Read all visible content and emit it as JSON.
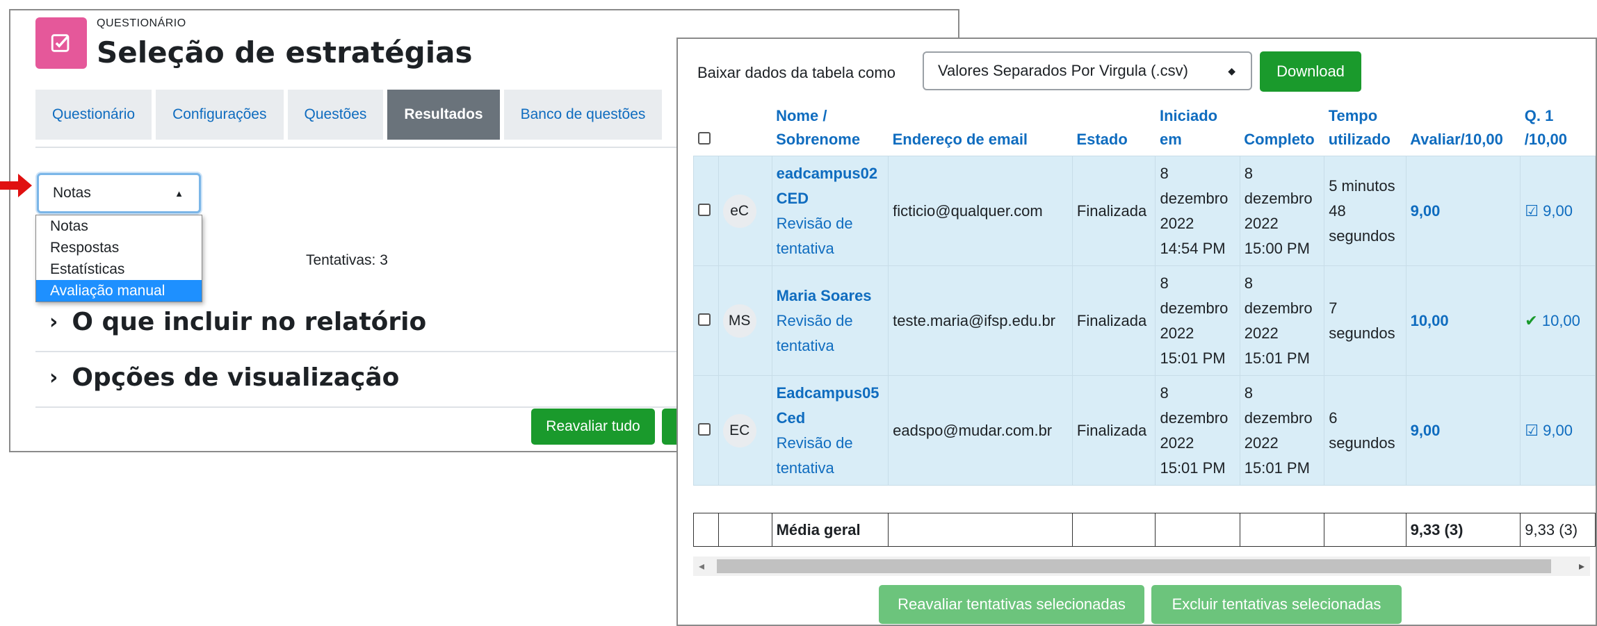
{
  "quiz": {
    "type_label": "QUESTIONÁRIO",
    "title": "Seleção de estratégias"
  },
  "tabs": [
    {
      "label": "Questionário"
    },
    {
      "label": "Configurações"
    },
    {
      "label": "Questões"
    },
    {
      "label": "Resultados",
      "active": true
    },
    {
      "label": "Banco de questões"
    }
  ],
  "report_select": {
    "value": "Notas",
    "options": [
      "Notas",
      "Respostas",
      "Estatísticas",
      "Avaliação manual"
    ],
    "highlighted": "Avaliação manual"
  },
  "tentativas": "Tentativas: 3",
  "sections": {
    "include": "O que incluir no relatório",
    "display": "Opções de visualização"
  },
  "regrade_all": "Reavaliar tudo",
  "export": {
    "label": "Baixar dados da tabela como",
    "format": "Valores Separados Por Virgula (.csv)",
    "download": "Download"
  },
  "headers": {
    "name1": "Nome /",
    "name2": "Sobrenome",
    "email": "Endereço de email",
    "state": "Estado",
    "started1": "Iniciado",
    "started2": "em",
    "completed": "Completo",
    "time1": "Tempo",
    "time2": "utilizado",
    "grade": "Avaliar/10,00",
    "q1a": "Q. 1",
    "q1b": "/10,00"
  },
  "rows": [
    {
      "initials": "eC",
      "name": "eadcampus02 CED",
      "review": "Revisão de tentativa",
      "email": "ficticio@qualquer.com",
      "state": "Finalizada",
      "started": "8 dezembro 2022 14:54 PM",
      "completed": "8 dezembro 2022 15:00 PM",
      "time": "5 minutos 48 segundos",
      "grade": "9,00",
      "q1": "9,00"
    },
    {
      "initials": "MS",
      "name": "Maria Soares",
      "review": "Revisão de tentativa",
      "email": "teste.maria@ifsp.edu.br",
      "state": "Finalizada",
      "started": "8 dezembro 2022 15:01 PM",
      "completed": "8 dezembro 2022 15:01 PM",
      "time": "7 segundos",
      "grade": "10,00",
      "q1": "10,00"
    },
    {
      "initials": "EC",
      "name": "Eadcampus05 Ced",
      "review": "Revisão de tentativa",
      "email": "eadspo@mudar.com.br",
      "state": "Finalizada",
      "started": "8 dezembro 2022 15:01 PM",
      "completed": "8 dezembro 2022 15:01 PM",
      "time": "6 segundos",
      "grade": "9,00",
      "q1": "9,00"
    }
  ],
  "summary": {
    "label": "Média geral",
    "grade": "9,33 (3)",
    "q1": "9,33 (3)"
  },
  "actions": {
    "regrade": "Reavaliar tentativas selecionadas",
    "delete": "Excluir tentativas selecionadas"
  },
  "colors": {
    "green": "#1a9a2c",
    "blue": "#0f6cbf",
    "row_bg": "#d9edf7",
    "pink": "#e5589a"
  }
}
